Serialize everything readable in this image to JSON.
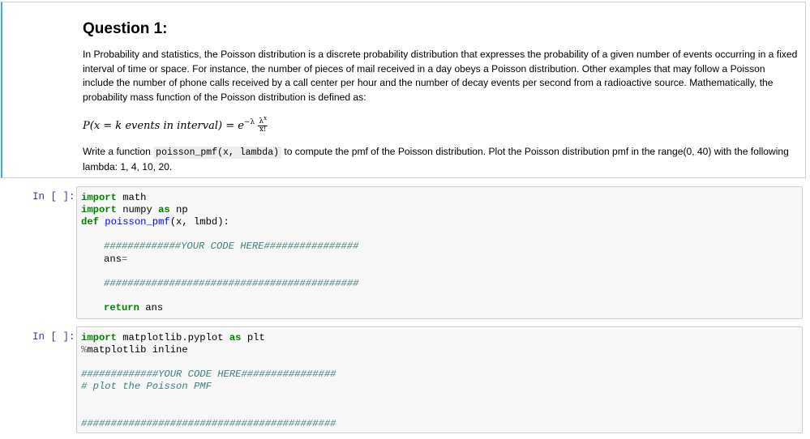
{
  "markdown": {
    "title": "Question 1:",
    "paragraph1": "In Probability and statistics, the Poisson distribution is a discrete probability distribution that expresses the probability of a given number of events occurring in a fixed interval of time or space. For instance, the number of pieces of mail received in a day obeys a Poisson distribution. Other examples that may follow a Poisson include the number of phone calls received by a call center per hour and the number of decay events per second from a radioactive source. Mathematically, the probability mass function of the Poisson distribution is defined as:",
    "formula": {
      "lhs": "P(x = k events in interval) = e",
      "exponent": "−λ",
      "numerator": "λ",
      "numerator_exp": "x",
      "denominator": "x!"
    },
    "paragraph2_before": "Write a function ",
    "paragraph2_code": "poisson_pmf(x, lambda)",
    "paragraph2_after": " to compute the pmf of the Poisson distribution. Plot the Poisson distribution pmf in the range(0, 40) with the following lambda: 1, 4, 10, 20."
  },
  "cell1": {
    "prompt": "In [ ]:",
    "lines": {
      "l1_kw": "import",
      "l1_rest": " math",
      "l2_kw": "import",
      "l2_mid": " numpy ",
      "l2_as": "as",
      "l2_rest": " np",
      "l3_kw": "def",
      "l3_fn": " poisson_pmf",
      "l3_rest": "(x, lmbd):",
      "l4_cm": "#############YOUR CODE HERE################",
      "l5_text": "ans",
      "l5_op": "=",
      "l6_cm": "###########################################",
      "l7_kw": "return",
      "l7_rest": " ans"
    }
  },
  "cell2": {
    "prompt": "In [ ]:",
    "lines": {
      "l1_kw": "import",
      "l1_mid": " matplotlib.pyplot ",
      "l1_as": "as",
      "l1_rest": " plt",
      "l2_op": "%",
      "l2_rest": "matplotlib inline",
      "l3_cm": "#############YOUR CODE HERE################",
      "l4_cm": "# plot the Poisson PMF",
      "l5_cm": "###########################################"
    }
  }
}
